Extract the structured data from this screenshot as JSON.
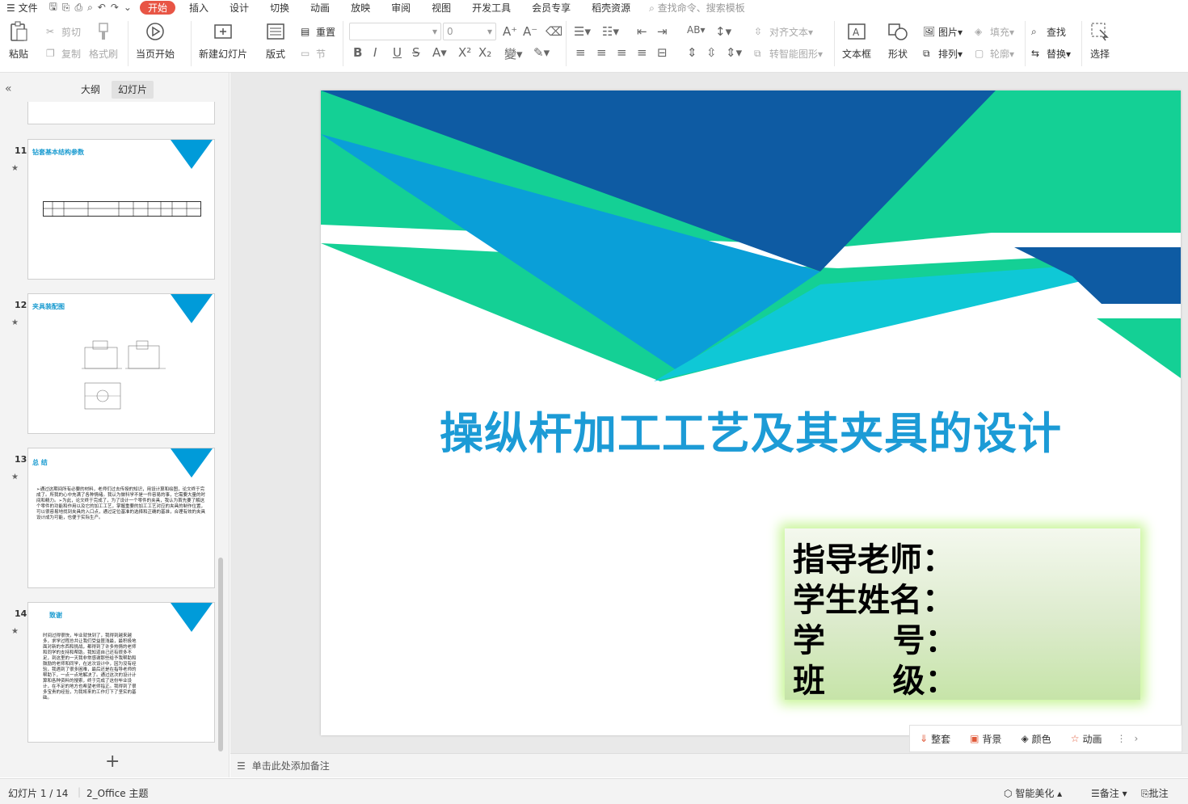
{
  "menubar": {
    "file_label": "文件",
    "tabs": [
      "开始",
      "插入",
      "设计",
      "切换",
      "动画",
      "放映",
      "审阅",
      "视图",
      "开发工具",
      "会员专享",
      "稻壳资源"
    ],
    "search_placeholder": "查找命令、搜索模板"
  },
  "ribbon": {
    "paste": "粘贴",
    "cut": "剪切",
    "copy": "复制",
    "format_painter": "格式刷",
    "from_current": "当页开始",
    "new_slide": "新建幻灯片",
    "layout": "版式",
    "reset": "重置",
    "section": "节",
    "font_size_value": "0",
    "align_text": "对齐文本",
    "smart_shape": "转智能图形",
    "textbox": "文本框",
    "shape": "形状",
    "arrange": "排列",
    "picture": "图片",
    "fill": "填充",
    "outline": "轮廓",
    "find": "查找",
    "replace": "替换",
    "select": "选择"
  },
  "panel": {
    "tab_outline": "大纲",
    "tab_slides": "幻灯片",
    "slides": [
      {
        "num": "11",
        "title": "钻套基本结构参数"
      },
      {
        "num": "12",
        "title": "夹具装配图"
      },
      {
        "num": "13",
        "title": "总    结",
        "body": "➢通过这期间所有必要的材料，老师们过去传授的知识，用设计算和绘图，论文终于完成了。所我的心中充满了各种情绪。我认为做科学不是一件容易的事，它需要大量的时间和精力。➢为此，论文终于完成了，为了设计一个零件的夹具，我认为首先要了解这个零件的功能和作用以及它的加工工艺，掌握重要的加工工艺对应的夹具的制作位置，可以很容易地找到夹具的入口点，通过定位基准的选择和正确的基准，合理有效的夹具设计成为可能，也便于实际生产。"
      },
      {
        "num": "14",
        "title": "致谢",
        "body": "时间过得很快，毕业就快到了，我得到越来越多，求学过程总共让我们受益匪浅最，最积极地面对新的东西和挑战，都得到了许多热情的老师和同学的支持和帮助。我知道自己还有很多不足，到这里的一天我非常感谢那些给予我帮助和鼓励的老师和同学，在这次设计中，因为没有经验，我遇到了很多困难，最后还是在指导老师的帮助下，一点一点地解决了。通过这次的设计计算和各种资料的搜索，终于完成了这份毕业设计，在不足的地方也希望老师指正。我得到了很多宝贵的经验，为我将来的工作打下了坚实的基础。"
      }
    ]
  },
  "slide": {
    "title": "操纵杆加工工艺及其夹具的设计",
    "info_lines": [
      "指导老师：",
      "学生姓名：",
      "学      号：",
      "班      级："
    ]
  },
  "floatbar": {
    "items": [
      "整套",
      "背景",
      "颜色",
      "动画"
    ]
  },
  "notes": {
    "placeholder": "单击此处添加备注"
  },
  "status": {
    "slide_counter": "幻灯片 1 / 14",
    "theme": "2_Office 主题",
    "beautify": "智能美化",
    "notes": "备注",
    "comments": "批注"
  },
  "colors": {
    "accent_tab": "#e85545",
    "dark_blue": "#0e5ba3",
    "mid_blue": "#0a9fd8",
    "green": "#14d095",
    "cyan": "#0fc8d6",
    "title_blue": "#1c9bd6"
  }
}
